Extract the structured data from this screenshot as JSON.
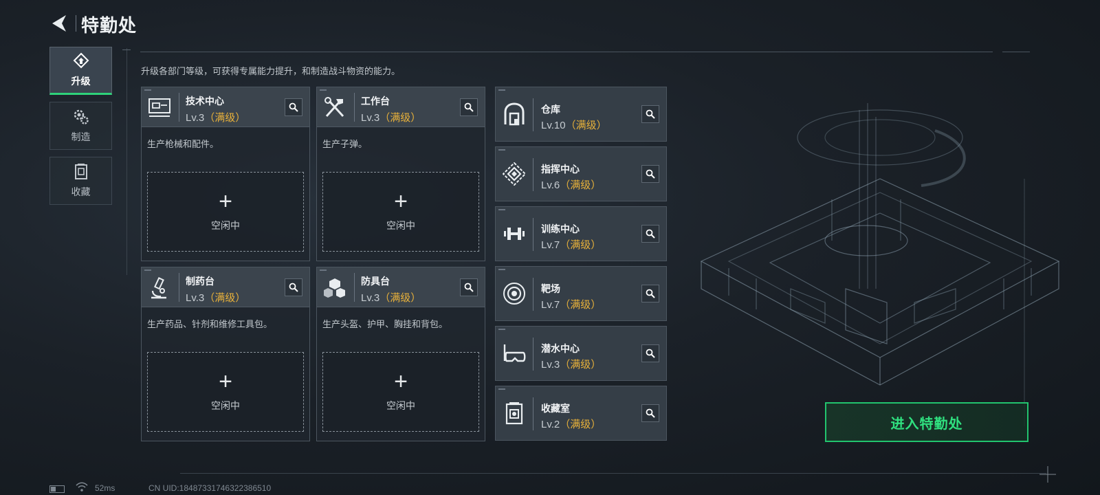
{
  "header": {
    "title": "特勤处"
  },
  "nav": {
    "items": [
      {
        "label": "升级",
        "icon": "upgrade-icon",
        "active": true
      },
      {
        "label": "制造",
        "icon": "gears-icon",
        "active": false
      },
      {
        "label": "收藏",
        "icon": "collection-icon",
        "active": false
      }
    ]
  },
  "intro": "升级各部门等级，可获得专属能力提升，和制造战斗物资的能力。",
  "cards": [
    {
      "title": "技术中心",
      "level": "Lv.3",
      "status": "（满级）",
      "desc": "生产枪械和配件。",
      "slot_label": "空闲中",
      "icon": "tech-center-icon"
    },
    {
      "title": "工作台",
      "level": "Lv.3",
      "status": "（满级）",
      "desc": "生产子弹。",
      "slot_label": "空闲中",
      "icon": "workbench-tools-icon"
    },
    {
      "title": "制药台",
      "level": "Lv.3",
      "status": "（满级）",
      "desc": "生产药品、针剂和维修工具包。",
      "slot_label": "空闲中",
      "icon": "microscope-icon"
    },
    {
      "title": "防具台",
      "level": "Lv.3",
      "status": "（满级）",
      "desc": "生产头盔、护甲、胸挂和背包。",
      "slot_label": "空闲中",
      "icon": "armor-cubes-icon"
    }
  ],
  "facilities": [
    {
      "title": "仓库",
      "level": "Lv.10",
      "status": "（满级）",
      "icon": "warehouse-icon"
    },
    {
      "title": "指挥中心",
      "level": "Lv.6",
      "status": "（满级）",
      "icon": "command-center-icon"
    },
    {
      "title": "训练中心",
      "level": "Lv.7",
      "status": "（满级）",
      "icon": "dumbbell-icon"
    },
    {
      "title": "靶场",
      "level": "Lv.7",
      "status": "（满级）",
      "icon": "target-icon"
    },
    {
      "title": "潜水中心",
      "level": "Lv.3",
      "status": "（满级）",
      "icon": "diving-mask-icon"
    },
    {
      "title": "收藏室",
      "level": "Lv.2",
      "status": "（满级）",
      "icon": "collection-room-icon"
    }
  ],
  "enter_button": {
    "label": "进入特勤处"
  },
  "status_bar": {
    "ping": "52ms",
    "uid": "CN UID:18487331746322386510"
  },
  "colors": {
    "accent_green": "#22c46e",
    "level_max": "#e8b13a"
  }
}
